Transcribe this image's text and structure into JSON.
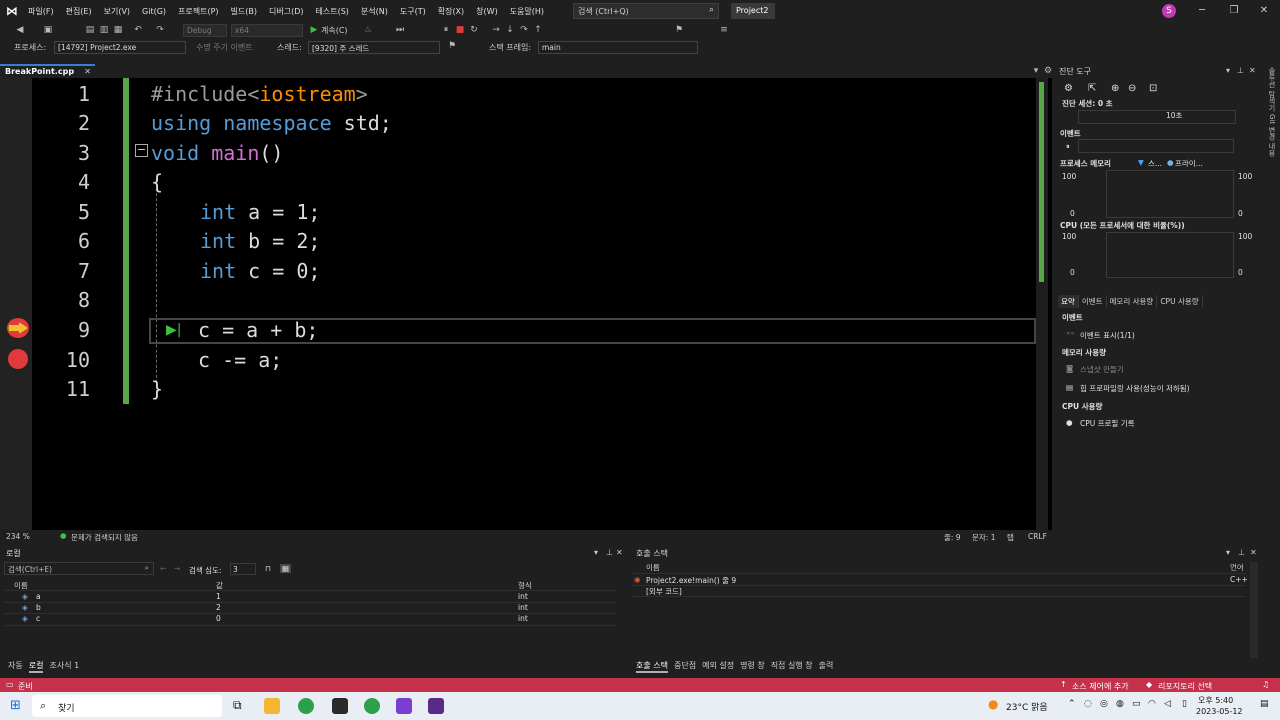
{
  "menubar": {
    "items": [
      "파일(F)",
      "편집(E)",
      "보기(V)",
      "Git(G)",
      "프로젝트(P)",
      "빌드(B)",
      "디버그(D)",
      "테스트(S)",
      "분석(N)",
      "도구(T)",
      "확장(X)",
      "창(W)",
      "도움말(H)"
    ],
    "search_placeholder": "검색 (Ctrl+Q)",
    "project_name": "Project2",
    "avatar_letter": "S"
  },
  "toolbar": {
    "config": "Debug",
    "platform": "x64",
    "continue_label": "계속(C)",
    "process_label": "프로세스:",
    "process_value": "[14792] Project2.exe",
    "lifecycle_label": "수명 주기 이벤트",
    "thread_label": "스레드:",
    "thread_value": "[9320] 주 스레드",
    "stackframe_label": "스택 프레임:",
    "stackframe_value": "main"
  },
  "editor": {
    "tab_name": "BreakPoint.cpp",
    "zoom": "234 %",
    "no_issues": "문제가 검색되지 않음",
    "line_pos": "줄: 9",
    "col_pos": "문자: 1",
    "tab_mode": "탭",
    "eol": "CRLF",
    "lines": [
      {
        "n": "1",
        "text": "#include<iostream>"
      },
      {
        "n": "2",
        "text": "using namespace std;"
      },
      {
        "n": "3",
        "text": "void main()"
      },
      {
        "n": "4",
        "text": "{"
      },
      {
        "n": "5",
        "text": "int a = 1;"
      },
      {
        "n": "6",
        "text": "int b = 2;"
      },
      {
        "n": "7",
        "text": "int c = 0;"
      },
      {
        "n": "8",
        "text": ""
      },
      {
        "n": "9",
        "text": "c = a + b;"
      },
      {
        "n": "10",
        "text": "c -= a;"
      },
      {
        "n": "11",
        "text": "}"
      }
    ]
  },
  "diag": {
    "title": "진단 도구",
    "session": "진단 세션: 0 초",
    "time_tick": "10초",
    "events_label": "이벤트",
    "memory_label": "프로세스 메모리",
    "memory_legend_1": "스...",
    "memory_legend_2": "프라이...",
    "cpu_label": "CPU (모든 프로세서에 대한 비율(%))",
    "axis_max": "100",
    "axis_min": "0",
    "tabs": [
      "요약",
      "이벤트",
      "메모리 사용량",
      "CPU 사용량"
    ],
    "summary_events_header": "이벤트",
    "show_events": "이벤트 표시(1/1)",
    "mem_usage_header": "메모리 사용량",
    "take_snapshot": "스냅샷 만들기",
    "heap_profiling": "힙 프로파일링 사용(성능이 저하됨)",
    "cpu_usage_header": "CPU 사용량",
    "record_cpu": "CPU 프로필 기록",
    "side_tabs": [
      "솔루션 탐색기",
      "Git 변경 내용"
    ]
  },
  "locals": {
    "title": "로컬",
    "search_placeholder": "검색(Ctrl+E)",
    "search_depth_label": "검색 심도:",
    "search_depth": "3",
    "columns": [
      "이름",
      "값",
      "형식"
    ],
    "rows": [
      {
        "name": "a",
        "value": "1",
        "type": "int"
      },
      {
        "name": "b",
        "value": "2",
        "type": "int"
      },
      {
        "name": "c",
        "value": "0",
        "type": "int"
      }
    ],
    "tabs": [
      "자동",
      "로컬",
      "조사식 1"
    ]
  },
  "callstack": {
    "title": "호출 스택",
    "columns": [
      "이름",
      "언어"
    ],
    "rows": [
      {
        "name": "Project2.exe!main() 줄 9",
        "lang": "C++"
      },
      {
        "name": "[외부 코드]",
        "lang": ""
      }
    ],
    "tabs": [
      "호출 스택",
      "중단점",
      "예외 설정",
      "명령 창",
      "직접 실행 창",
      "출력"
    ]
  },
  "statusbar": {
    "ready": "준비",
    "source_control": "소스 제어에 추가",
    "repo": "리포지토리 선택"
  },
  "taskbar": {
    "search": "찾기",
    "weather": "23°C  맑음",
    "time": "오후 5:40",
    "date": "2023-05-12"
  },
  "colors": {
    "keyword": "#569cd6",
    "function": "#d670d6",
    "include_string": "#ff8c00",
    "change_bar": "#57a64a",
    "breakpoint": "#e03a3a",
    "statusbar": "#c4314b"
  }
}
